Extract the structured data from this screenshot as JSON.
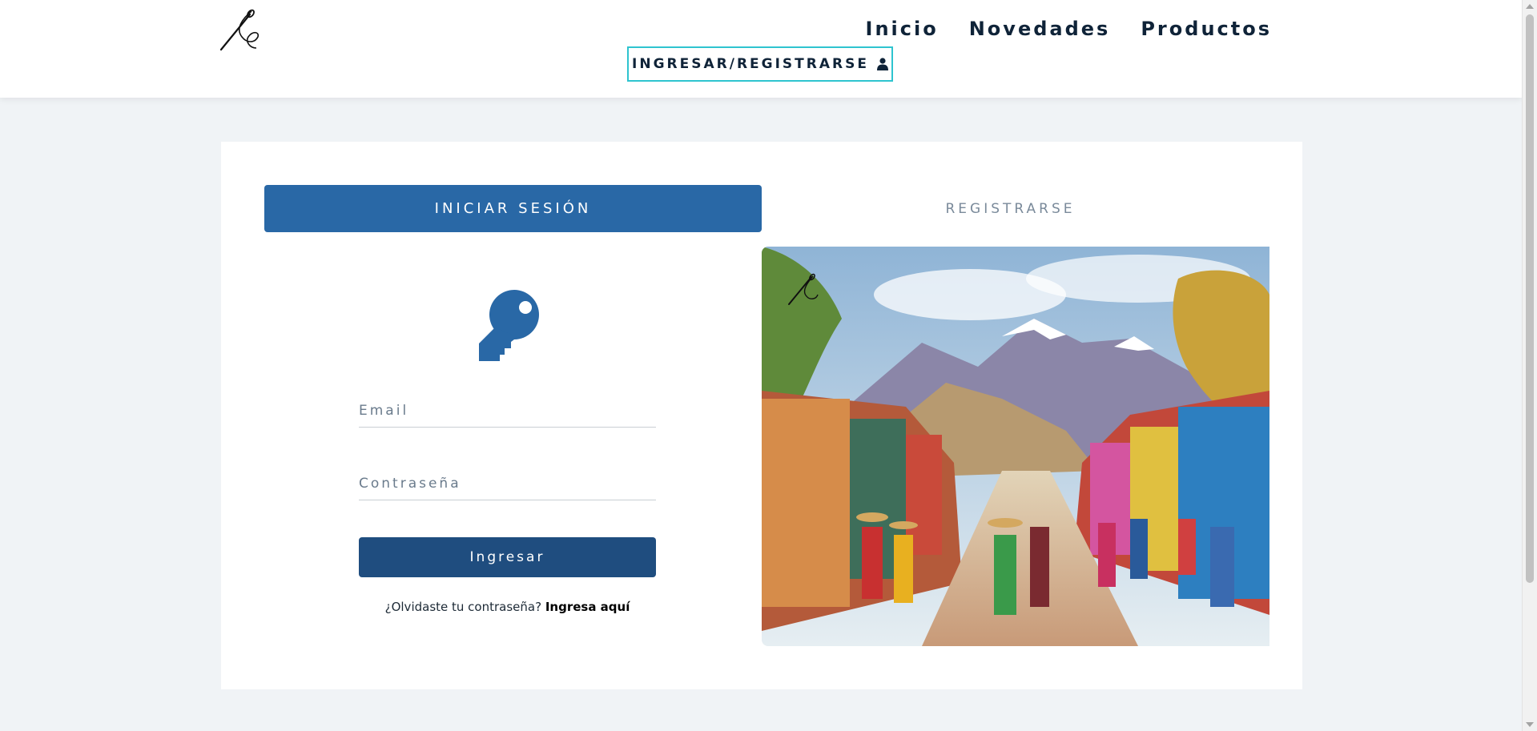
{
  "header": {
    "logo_icon": "needle-thread-logo",
    "nav": [
      {
        "label": "Inicio"
      },
      {
        "label": "Novedades"
      },
      {
        "label": "Productos"
      }
    ],
    "login_button": {
      "label": "INGRESAR/REGISTRARSE",
      "icon": "user-icon"
    }
  },
  "auth_card": {
    "tabs": {
      "login": "INICIAR SESIÓN",
      "register": "REGISTRARSE"
    },
    "key_icon": "key-icon",
    "form": {
      "email_placeholder": "Email",
      "email_value": "",
      "password_placeholder": "Contraseña",
      "password_value": "",
      "submit_label": "Ingresar",
      "forgot_text": "¿Olvidaste tu contraseña?",
      "forgot_link": "Ingresa aquí"
    },
    "image": {
      "subject": "painting of an Andean village street with women in colorful skirts and hats, snowy mountains behind",
      "overlay_logo": "needle-thread-logo"
    }
  },
  "colors": {
    "primary": "#2968a6",
    "primary_dark": "#1f4d7f",
    "accent_border": "#2ec4cf",
    "nav_text": "#0f2338",
    "page_bg": "#f0f3f6"
  }
}
